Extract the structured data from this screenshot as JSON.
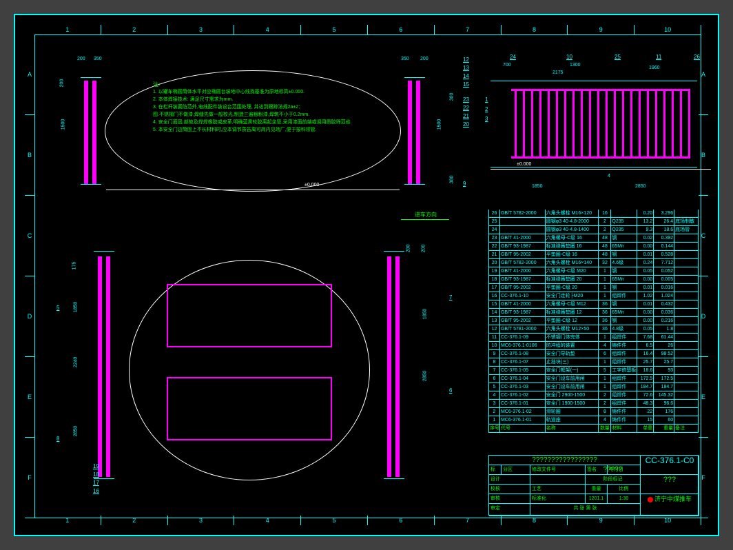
{
  "ruler_h": [
    "1",
    "2",
    "3",
    "4",
    "5",
    "6",
    "7",
    "8",
    "9",
    "10"
  ],
  "ruler_v": [
    "A",
    "B",
    "C",
    "D",
    "E",
    "F"
  ],
  "notes": {
    "title": "注:",
    "lines": [
      "1. 以罐车椭圆筒体水平对应椭圆台装地中心线找基准为原地标高±0.000.",
      "2. 本体焊接技术: 满足尺寸需求为mm.",
      "3. 在栏杆装置防范外,电线配件装设台范围处理, 并达到跟踪法规2a±2：",
      "   图.不锈钢门不做漆,焊缝先做一般校光,制造三遍银粉漆,焊筑不小于0.2mm.",
      "4. 安全门面固,部故及焊焊橡胶或皮革,明确蓝黑轮胶离起坐管,采用漆面前端或调用质胶筛范省.",
      "5. 本安全门边筒固上不长材料时,应本调节质告离可简内见场厂,便于按科领管."
    ]
  },
  "datum": "±0.000",
  "direction_label": "进车方向",
  "dims": {
    "v1_200": "200",
    "v1_350": "350",
    "v1_1500": "1500",
    "v1_200b": "200",
    "v1_350b": "350",
    "v1_200c": "200",
    "v1_380": "380",
    "v1_300": "300",
    "v2_700": "700",
    "v2_1300": "1300",
    "v2_2175": "2175",
    "v2_1960": "1960",
    "v2_1850": "1850",
    "v2_2850": "2850",
    "v2_4": "4",
    "v3_175": "175",
    "v3_1850": "1850",
    "v3_2240": "2240",
    "v3_2850": "2850",
    "v3_1850b": "1850",
    "v3_200": "200",
    "v3_200b": "200"
  },
  "balloons_v1_right": [
    "12",
    "13",
    "14",
    "15",
    "23",
    "22",
    "21",
    "20",
    "9"
  ],
  "balloons_v2": [
    "24",
    "10",
    "25",
    "11",
    "26",
    "1",
    "2",
    "3"
  ],
  "balloons_v3": [
    "5",
    "7",
    "6",
    "8",
    "19",
    "18",
    "17",
    "16"
  ],
  "bom_header": [
    "序号",
    "代号",
    "名称",
    "数量",
    "材料",
    "单重",
    "重量",
    "备注"
  ],
  "bom": [
    {
      "n": "26",
      "c": "GB/T 5782-2000",
      "name": "六角头螺栓 M16×120",
      "q": "16",
      "m": "",
      "w1": "0.20",
      "w2": "3.296",
      "r": ""
    },
    {
      "n": "25",
      "c": "",
      "name": "圆钢φ3 40·4.8-2000",
      "q": "2",
      "m": "Q235",
      "w1": "13.2",
      "w2": "26.4",
      "r": "底场制敏"
    },
    {
      "n": "24",
      "c": "",
      "name": "圆钢φ3 40·4.8-1400",
      "q": "2",
      "m": "Q235",
      "w1": "9.3",
      "w2": "18.6",
      "r": "底场管"
    },
    {
      "n": "23",
      "c": "GB/T 41-2000",
      "name": "六角螺母-C级 16",
      "q": "48",
      "m": "钢",
      "w1": "0.02",
      "w2": "0.392",
      "r": ""
    },
    {
      "n": "22",
      "c": "GB/T 93-1987",
      "name": "标准弹簧垫圈 16",
      "q": "48",
      "m": "65Mn",
      "w1": "0.00",
      "w2": "0.144",
      "r": ""
    },
    {
      "n": "21",
      "c": "GB/T 95-2002",
      "name": "平垫圈-C级 16",
      "q": "48",
      "m": "钢",
      "w1": "0.01",
      "w2": "0.528",
      "r": ""
    },
    {
      "n": "20",
      "c": "GB/T 5782-2000",
      "name": "六角头螺栓 M16×140",
      "q": "32",
      "m": "4.6级",
      "w1": "0.24",
      "w2": "7.712",
      "r": ""
    },
    {
      "n": "19",
      "c": "GB/T 41-2000",
      "name": "六角螺母-C级  M20",
      "q": "1",
      "m": "钢",
      "w1": "0.05",
      "w2": "0.052",
      "r": ""
    },
    {
      "n": "18",
      "c": "GB/T 93-1987",
      "name": "标准弹簧垫圈 20",
      "q": "1",
      "m": "65Mn",
      "w1": "0.00",
      "w2": "0.005",
      "r": ""
    },
    {
      "n": "17",
      "c": "GB/T 95-2002",
      "name": "平垫圈-C级  20",
      "q": "1",
      "m": "钢",
      "w1": "0.01",
      "w2": "0.016",
      "r": ""
    },
    {
      "n": "16",
      "c": "CC-376.1-10",
      "name": "安全门走轮├M20",
      "q": "1",
      "m": "组焊件",
      "w1": "1.02",
      "w2": "1.024",
      "r": ""
    },
    {
      "n": "15",
      "c": "GB/T 41-2000",
      "name": "六角螺母-C级  M12",
      "q": "36",
      "m": "钢",
      "w1": "0.01",
      "w2": "0.432",
      "r": ""
    },
    {
      "n": "14",
      "c": "GB/T 93-1987",
      "name": "标准弹簧垫圈 12",
      "q": "36",
      "m": "65Mn",
      "w1": "0.00",
      "w2": "0.036",
      "r": ""
    },
    {
      "n": "13",
      "c": "GB/T 95-2002",
      "name": "平垫圈-C级  12",
      "q": "36",
      "m": "钢",
      "w1": "0.00",
      "w2": "0.216",
      "r": ""
    },
    {
      "n": "12",
      "c": "GB/T 5781-2000",
      "name": "六角头螺栓 M12×50",
      "q": "36",
      "m": "4.8级",
      "w1": "0.05",
      "w2": "1.8",
      "r": ""
    },
    {
      "n": "11",
      "c": "CC-376.1-09",
      "name": "不锈钢门体完体",
      "q": "1",
      "m": "组焊件",
      "w1": "7.68",
      "w2": "61.44",
      "r": ""
    },
    {
      "n": "10",
      "c": "MC6-376.1-0106",
      "name": "防冲程的装置",
      "q": "4",
      "m": "铸件件",
      "w1": "6.5",
      "w2": "26",
      "r": ""
    },
    {
      "n": "9",
      "c": "CC-376.1-08",
      "name": "安全门导轨垫",
      "q": "6",
      "m": "组焊件",
      "w1": "16.4",
      "w2": "98.52",
      "r": ""
    },
    {
      "n": "8",
      "c": "CC-376.1-07",
      "name": "止挡块(三)",
      "q": "1",
      "m": "组焊件",
      "w1": "25.7",
      "w2": "25.7",
      "r": ""
    },
    {
      "n": "7",
      "c": "CC-376.1-05",
      "name": "安全门框架(一)",
      "q": "5",
      "m": "工字俯楚板件",
      "w1": "18.6",
      "w2": "93",
      "r": ""
    },
    {
      "n": "6",
      "c": "CC-376.1-04",
      "name": "安全门设车前用闸",
      "q": "1",
      "m": "组焊件",
      "w1": "172.5",
      "w2": "172.5",
      "r": ""
    },
    {
      "n": "5",
      "c": "CC-376.1-03",
      "name": "安全门设车前用闸",
      "q": "1",
      "m": "组焊件",
      "w1": "184.7",
      "w2": "184.7",
      "r": ""
    },
    {
      "n": "4",
      "c": "CC-376.1-02",
      "name": "安全门  2900-1500",
      "q": "2",
      "m": "组焊件",
      "w1": "72.6",
      "w2": "145.32",
      "r": ""
    },
    {
      "n": "3",
      "c": "CC-376.1-01",
      "name": "安全门  1900-1500",
      "q": "2",
      "m": "组焊件",
      "w1": "48.3",
      "w2": "96.6",
      "r": ""
    },
    {
      "n": "2",
      "c": "MC6-376.1-02",
      "name": "滑轮圈",
      "q": "8",
      "m": "铸件件",
      "w1": "22",
      "w2": "176",
      "r": ""
    },
    {
      "n": "1",
      "c": "MC6-376.1-01",
      "name": "轨道座",
      "q": "4",
      "m": "铸件件",
      "w1": "15",
      "w2": "60",
      "r": ""
    }
  ],
  "title_block": {
    "big_name": "?????????????????",
    "name5": "?????",
    "drawing_no": "CC-376.1-C0",
    "q3": "???",
    "designed": "设计",
    "checked": "校核",
    "approved": "审核",
    "process": "工艺",
    "std": "标准化",
    "appr": "审定",
    "stage_label": "阶段标记",
    "weight_label": "重量",
    "scale_label": "比例",
    "wt": "1201.1",
    "scale": "1:30",
    "sheet": "共  张   第  张",
    "company": "济宁中煤推车",
    "zone": "分区",
    "change": "修改文件号",
    "sign": "签名",
    "date": "年月日",
    "mark": "标记"
  }
}
